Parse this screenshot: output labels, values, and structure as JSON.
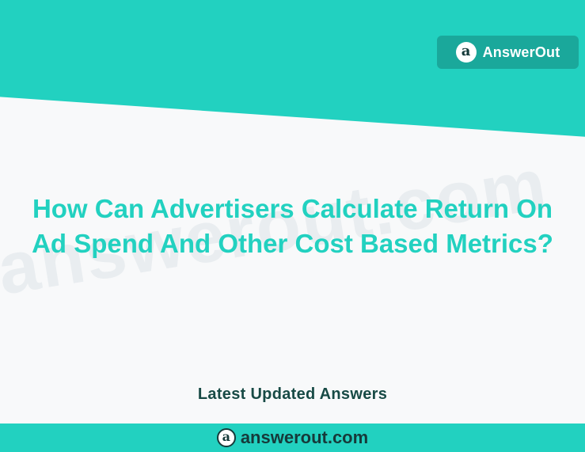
{
  "brand": {
    "logo_glyph": "a",
    "name": "AnswerOut"
  },
  "watermark": "answerout.com",
  "headline": {
    "line1": "How Can Advertisers Calculate Return On",
    "line2": "Ad Spend And Other Cost Based Metrics?"
  },
  "section_label": "Latest Updated Answers",
  "footer": {
    "logo_glyph": "a",
    "url": "answerout.com"
  },
  "colors": {
    "accent": "#22d1c0",
    "badge": "#1aa89b",
    "dark_text": "#163a3a",
    "background": "#f8f9fa"
  }
}
